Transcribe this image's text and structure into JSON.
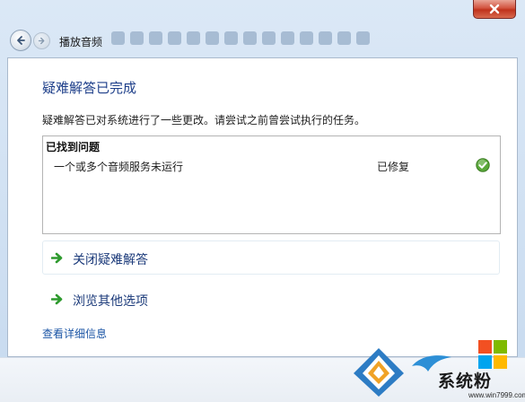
{
  "window": {
    "title": "播放音频"
  },
  "content": {
    "heading": "疑难解答已完成",
    "description": "疑难解答已对系统进行了一些更改。请尝试之前曾尝试执行的任务。",
    "problems": {
      "header": "已找到问题",
      "items": [
        {
          "name": "一个或多个音频服务未运行",
          "status": "已修复",
          "icon": "check-icon"
        }
      ]
    },
    "actions": [
      {
        "label": "关闭疑难解答",
        "icon": "green-arrow-icon"
      },
      {
        "label": "浏览其他选项",
        "icon": "green-arrow-icon"
      }
    ],
    "details_link": "查看详细信息"
  },
  "watermark": {
    "brand": "系统粉",
    "url": "www.win7999.com"
  },
  "colors": {
    "heading": "#1e3f8a",
    "link": "#1b55a5",
    "check": "#4a9b2f",
    "arrow": "#2e9a2e",
    "close": "#c9412b"
  }
}
